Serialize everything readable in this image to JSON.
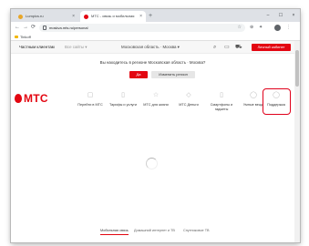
{
  "browser": {
    "tabs": [
      {
        "label": "Lumpics.ru",
        "close": "×"
      },
      {
        "label": "МТС - связь и мобильная",
        "close": "×"
      }
    ],
    "new_tab": "+",
    "window_controls": [
      "–",
      "☐",
      "×"
    ],
    "nav": {
      "back": "←",
      "forward": "→",
      "reload": "⟳"
    },
    "address": "moskva.mts.ru/personal",
    "bookmarks": [
      {
        "label": "Tinkoff"
      }
    ]
  },
  "page": {
    "topbar": {
      "private_clients": "Частным клиентам",
      "all_sites": "Все сайты ▾",
      "region": "Московская область · Москва ▾",
      "personal_cabinet": "Личный кабинет"
    },
    "region_prompt": {
      "question": "Вы находитесь в регионе Московская область · Москва?",
      "yes": "Да",
      "change": "Изменить регион"
    },
    "logo_text": "МТС",
    "main_nav": [
      {
        "label": "Перейти в МТС",
        "icon": "sim-card-icon"
      },
      {
        "label": "Тарифы и услуги",
        "icon": "phone-icon"
      },
      {
        "label": "МТС для жизни",
        "icon": "star-icon"
      },
      {
        "label": "МТС Деньги",
        "icon": "wallet-icon"
      },
      {
        "label": "Смартфоны и гаджеты",
        "icon": "smartphone-icon"
      },
      {
        "label": "Умные вещи",
        "icon": "smart-device-icon"
      },
      {
        "label": "Поддержка",
        "icon": "support-icon"
      }
    ],
    "bottom_tabs": [
      {
        "label": "Мобильная связь"
      },
      {
        "label": "Домашний интернет и ТВ"
      },
      {
        "label": "Спутниковое ТВ"
      }
    ]
  },
  "colors": {
    "brand": "#e30611",
    "highlight": "#e0001b"
  }
}
